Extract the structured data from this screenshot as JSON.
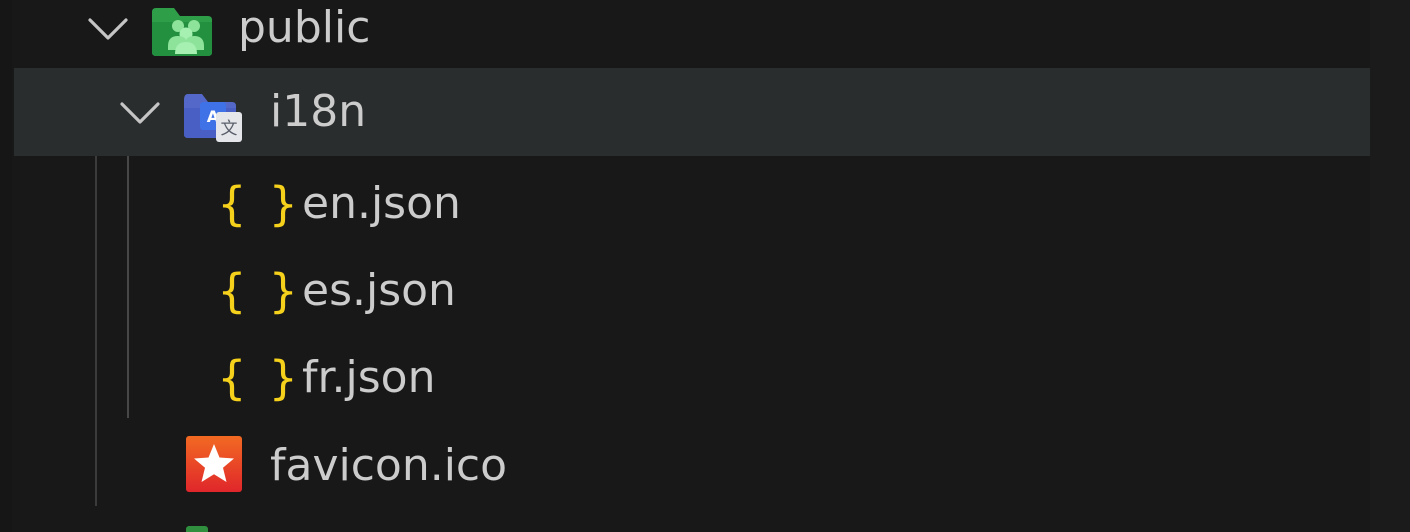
{
  "explorer": {
    "items": [
      {
        "label": "public",
        "kind": "folder",
        "expanded": true,
        "icon": "folder-public-icon"
      },
      {
        "label": "i18n",
        "kind": "folder",
        "expanded": true,
        "selected": true,
        "icon": "folder-i18n-icon"
      },
      {
        "label": "en.json",
        "kind": "file",
        "icon": "json-braces-icon",
        "icon_glyph": "{ }"
      },
      {
        "label": "es.json",
        "kind": "file",
        "icon": "json-braces-icon",
        "icon_glyph": "{ }"
      },
      {
        "label": "fr.json",
        "kind": "file",
        "icon": "json-braces-icon",
        "icon_glyph": "{ }"
      },
      {
        "label": "favicon.ico",
        "kind": "file",
        "icon": "favicon-star-icon"
      }
    ]
  },
  "colors": {
    "background": "#181818",
    "selected_row": "#2a2d2e",
    "text": "#cccccc",
    "json_icon": "#f5d11c",
    "public_folder": "#2e9e48",
    "i18n_folder": "#5468c9",
    "favicon": "#ea3a22"
  }
}
